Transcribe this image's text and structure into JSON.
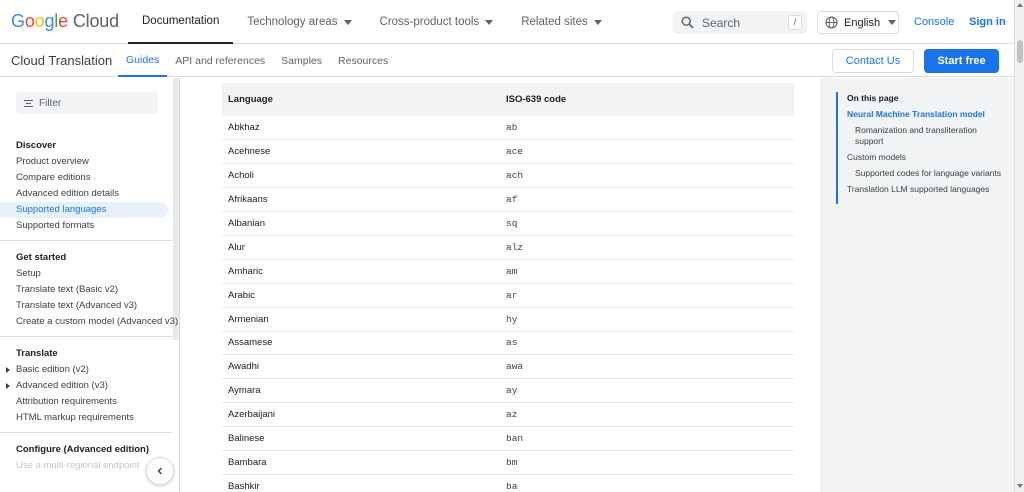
{
  "header": {
    "logo": {
      "g1": "G",
      "g2": "o",
      "g3": "o",
      "g4": "g",
      "g5": "l",
      "g6": "e",
      "cloud": "Cloud"
    },
    "nav": [
      "Documentation",
      "Technology areas",
      "Cross-product tools",
      "Related sites"
    ],
    "active_nav": "Documentation",
    "search_placeholder": "Search",
    "search_shortcut": "/",
    "language": "English",
    "console": "Console",
    "sign_in": "Sign in"
  },
  "subheader": {
    "product": "Cloud Translation",
    "tabs": [
      "Guides",
      "API and references",
      "Samples",
      "Resources"
    ],
    "active_tab": "Guides",
    "contact_us": "Contact Us",
    "start_free": "Start free"
  },
  "sidebar": {
    "filter_placeholder": "Filter",
    "sections": [
      {
        "title": "Discover",
        "items": [
          "Product overview",
          "Compare editions",
          "Advanced edition details",
          "Supported languages",
          "Supported formats"
        ]
      },
      {
        "title": "Get started",
        "items": [
          "Setup",
          "Translate text (Basic v2)",
          "Translate text (Advanced v3)",
          "Create a custom model (Advanced v3)"
        ]
      },
      {
        "title": "Translate",
        "items": [
          "Basic edition (v2)",
          "Advanced edition (v3)",
          "Attribution requirements",
          "HTML markup requirements"
        ]
      },
      {
        "title": "Configure (Advanced edition)",
        "items": [
          "Use a multi-regional endpoint"
        ]
      }
    ],
    "active_item": "Supported languages"
  },
  "table": {
    "headers": [
      "Language",
      "ISO-639 code"
    ],
    "rows": [
      [
        "Abkhaz",
        "ab"
      ],
      [
        "Acehnese",
        "ace"
      ],
      [
        "Acholi",
        "ach"
      ],
      [
        "Afrikaans",
        "af"
      ],
      [
        "Albanian",
        "sq"
      ],
      [
        "Alur",
        "alz"
      ],
      [
        "Amharic",
        "am"
      ],
      [
        "Arabic",
        "ar"
      ],
      [
        "Armenian",
        "hy"
      ],
      [
        "Assamese",
        "as"
      ],
      [
        "Awadhi",
        "awa"
      ],
      [
        "Aymara",
        "ay"
      ],
      [
        "Azerbaijani",
        "az"
      ],
      [
        "Balinese",
        "ban"
      ],
      [
        "Bambara",
        "bm"
      ],
      [
        "Bashkir",
        "ba"
      ]
    ]
  },
  "toc": {
    "title": "On this page",
    "items": [
      {
        "label": "Neural Machine Translation model",
        "level": 1,
        "active": true
      },
      {
        "label": "Romanization and transliteration support",
        "level": 2
      },
      {
        "label": "Custom models",
        "level": 1
      },
      {
        "label": "Supported codes for language variants",
        "level": 2
      },
      {
        "label": "Translation LLM supported languages",
        "level": 1
      }
    ]
  },
  "colors": {
    "accent": "#1a73e8",
    "border": "#dadce0",
    "panel": "#f1f3f4"
  }
}
